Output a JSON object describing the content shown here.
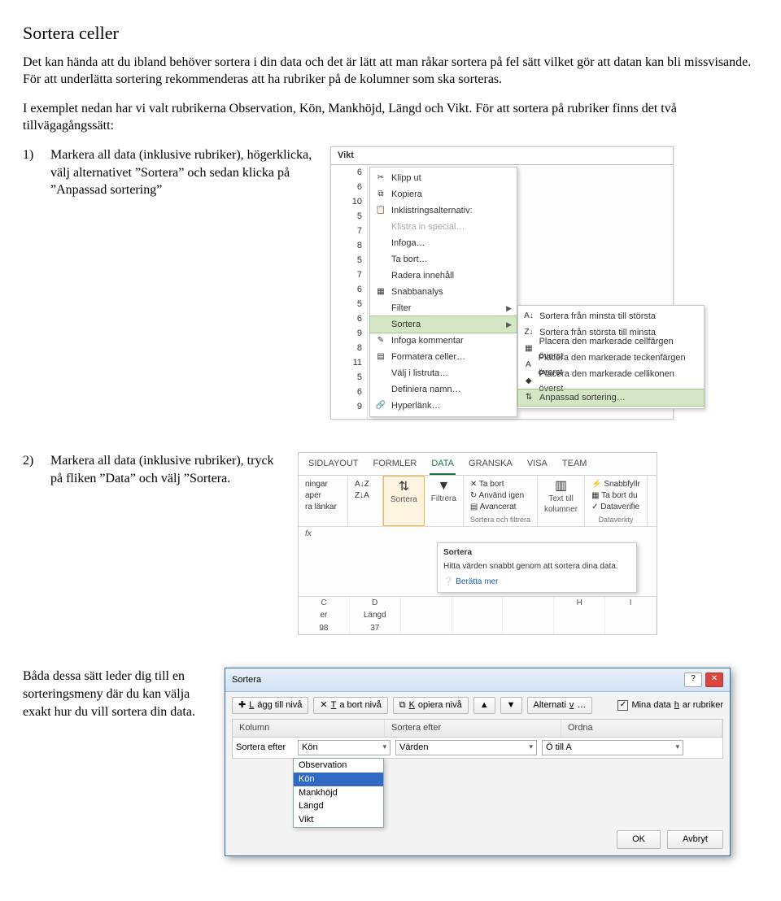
{
  "title": "Sortera celler",
  "intro_p1": "Det kan hända att du ibland behöver sortera i din data och det är lätt att man råkar sortera på fel sätt vilket gör att datan kan bli missvisande. För att underlätta sortering rekommenderas att ha rubriker på de kolumner som ska sorteras.",
  "intro_p2": "I exemplet nedan har vi valt rubrikerna Observation, Kön, Mankhöjd, Längd och Vikt. För att sortera på rubriker finns det två tillvägagångssätt:",
  "step1_num": "1)",
  "step1": "Markera all data (inklusive rubriker), högerklicka, välj alternativet ”Sortera” och sedan klicka på ”Anpassad sortering”",
  "step2_num": "2)",
  "step2": "Markera all data (inklusive rubriker), tryck på fliken ”Data” och välj ”Sortera.",
  "closing": "Båda dessa sätt leder dig till en sorteringsmeny där du kan välja exakt hur du vill sortera din data.",
  "ctx": {
    "header": "Vikt",
    "nums": [
      "6",
      "6",
      "10",
      "5",
      "7",
      "8",
      "5",
      "7",
      "6",
      "5",
      "6",
      "9",
      "8",
      "11",
      "5",
      "6",
      "9"
    ],
    "menu": {
      "klipp": "Klipp ut",
      "kopiera": "Kopiera",
      "paste_opts": "Inklistringsalternativ:",
      "klistra": "Klistra in special…",
      "infoga": "Infoga…",
      "tabort": "Ta bort…",
      "radera": "Radera innehåll",
      "snabb": "Snabbanalys",
      "filter": "Filter",
      "sortera": "Sortera",
      "kommentar": "Infoga kommentar",
      "formatera": "Formatera celler…",
      "listruta": "Välj i listruta…",
      "definiera": "Definiera namn…",
      "hyperlank": "Hyperlänk…"
    },
    "submenu": {
      "asc": "Sortera från minsta till största",
      "desc": "Sortera från största till minsta",
      "cellcolor": "Placera den markerade cellfärgen överst",
      "fontcolor": "Placera den markerade teckenfärgen överst",
      "icon": "Placera den markerade cellikonen överst",
      "custom": "Anpassad sortering…"
    }
  },
  "ribbon": {
    "tabs": {
      "sidlayout": "SIDLAYOUT",
      "formler": "FORMLER",
      "data": "DATA",
      "granska": "GRANSKA",
      "visa": "VISA",
      "team": "TEAM"
    },
    "left": {
      "ningar": "ningar",
      "aper": "aper",
      "ralankar": "ra länkar"
    },
    "sortera_lbl": "Sortera",
    "filtrera_lbl": "Filtrera",
    "az": "A↓Z",
    "za": "Z↓A",
    "tabort": "Ta bort",
    "anvand": "Använd igen",
    "avancerat": "Avancerat",
    "grp_sf": "Sortera och filtrera",
    "text_till": "Text till\nkolumner",
    "snabbfyllr": "Snabbfyllr",
    "tabort_du": "Ta bort du",
    "dataverifie": "Dataverifie",
    "grp_dv": "Dataverkty",
    "tip_title": "Sortera",
    "tip_body": "Hitta värden snabbt genom att sortera dina data.",
    "tip_link": "Berätta mer",
    "cols": {
      "c": "C",
      "d": "D",
      "h": "H",
      "i": "I"
    },
    "data_h1": "er",
    "data_h2": "Längd",
    "data_v1": "98",
    "data_v2": "37",
    "fx": "fx"
  },
  "dlg": {
    "title": "Sortera",
    "add": "Lägg till nivå",
    "del": "Ta bort nivå",
    "copy": "Kopiera nivå",
    "opts": "Alternativ…",
    "has_headers": "Mina data har rubriker",
    "col_h": "Kolumn",
    "sort_h": "Sortera efter",
    "ord_h": "Ordna",
    "row_lbl": "Sortera efter",
    "row_col": "Kön",
    "row_sort": "Värden",
    "row_ord": "Ö till A",
    "drop": [
      "Observation",
      "Kön",
      "Mankhöjd",
      "Längd",
      "Vikt"
    ],
    "ok": "OK",
    "cancel": "Avbryt"
  }
}
